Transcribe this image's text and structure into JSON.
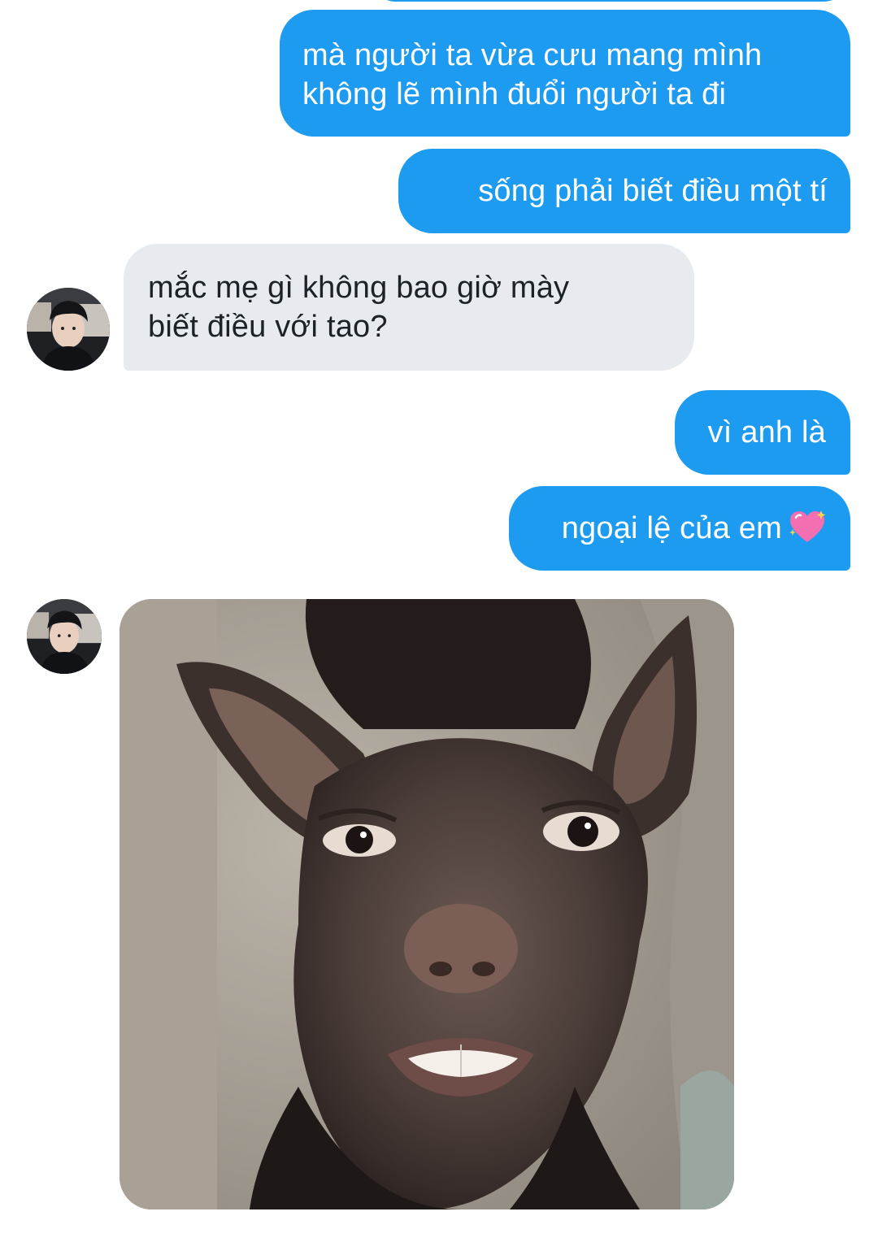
{
  "conversation": {
    "messages": [
      {
        "side": "outgoing",
        "lines": [
          "mà người ta vừa cưu mang mình",
          "không lẽ mình đuổi người ta đi"
        ]
      },
      {
        "side": "outgoing",
        "lines": [
          "sống phải biết điều một tí"
        ]
      },
      {
        "side": "incoming",
        "lines": [
          "mắc mẹ gì không bao giờ mày",
          "biết điều với tao?"
        ]
      },
      {
        "side": "outgoing",
        "lines": [
          "vì anh là"
        ]
      },
      {
        "side": "outgoing",
        "lines": [
          "ngoại lệ của em"
        ],
        "trailing_emoji": "sparkling-heart-emoji"
      },
      {
        "side": "incoming",
        "type": "image",
        "media": "meme-dog-human-face-image"
      }
    ]
  },
  "theme": {
    "outgoing_bubble_color": "#1d9bf0",
    "incoming_bubble_color": "#e7ebef",
    "outgoing_text_color": "#ffffff",
    "incoming_text_color": "#1b2228"
  }
}
